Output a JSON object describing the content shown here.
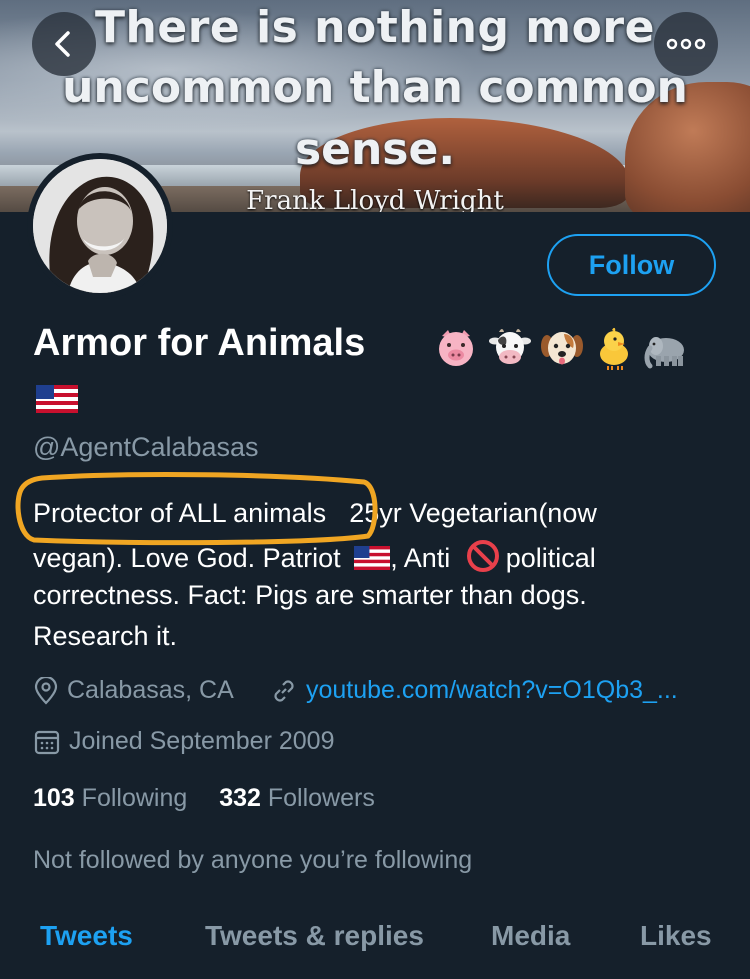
{
  "banner": {
    "quote_line1": "There is nothing more",
    "quote_line2": "uncommon than common",
    "quote_line3": "sense.",
    "quote_author": "Frank Lloyd Wright"
  },
  "profile": {
    "display_name": "Armor for Animals",
    "name_emojis": [
      "pig-face",
      "cow-face",
      "dog-face",
      "baby-chick",
      "elephant",
      "us-flag"
    ],
    "handle": "@AgentCalabasas",
    "follow_label": "Follow"
  },
  "bio": {
    "line1_highlighted": "Protector of ALL animals",
    "line1_rest": "25yr Vegetarian(now",
    "line2_a": "vegan). Love God. Patriot",
    "line2_b": ", Anti",
    "line2_c": "political",
    "line3": "correctness. Fact: Pigs are smarter than dogs.",
    "line4": "Research it."
  },
  "meta": {
    "location": "Calabasas, CA",
    "website": "youtube.com/watch?v=O1Qb3_...",
    "joined": "Joined September 2009"
  },
  "stats": {
    "following_count": "103",
    "following_label": "Following",
    "followers_count": "332",
    "followers_label": "Followers"
  },
  "social_context": "Not followed by anyone you’re following",
  "tabs": [
    {
      "label": "Tweets",
      "active": true
    },
    {
      "label": "Tweets & replies",
      "active": false
    },
    {
      "label": "Media",
      "active": false
    },
    {
      "label": "Likes",
      "active": false
    }
  ],
  "colors": {
    "background": "#15202b",
    "accent": "#1da1f2",
    "secondary_text": "#8899a6",
    "highlight_marker": "#f0a623"
  }
}
